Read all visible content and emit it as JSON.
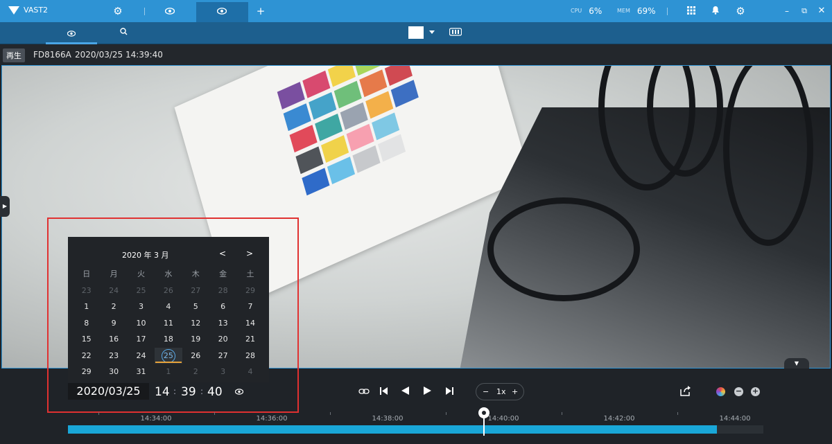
{
  "topbar": {
    "app_name": "VAST2",
    "cpu_label": "CPU",
    "cpu_value": "6%",
    "mem_label": "MEM",
    "mem_value": "69%",
    "icons": [
      "gear-icon",
      "eye-icon",
      "eye-icon",
      "plus-icon",
      "grid-icon",
      "bell-icon",
      "gear-icon",
      "minimize-icon",
      "restore-icon",
      "close-icon"
    ]
  },
  "subbar": {
    "icons": [
      "eye-icon",
      "search-icon",
      "color-swatch",
      "chevron-down-icon",
      "film-icon"
    ],
    "swatch_color": "#ffffff"
  },
  "camera": {
    "mode": "再生",
    "name": "FD8166A",
    "timestamp": "2020/03/25 14:39:40"
  },
  "calendar": {
    "header": "2020 年 3 月",
    "prev": "<",
    "next": ">",
    "weekdays": [
      "日",
      "月",
      "火",
      "水",
      "木",
      "金",
      "土"
    ],
    "days": [
      [
        "23",
        "24",
        "25",
        "26",
        "27",
        "28",
        "29"
      ],
      [
        "1",
        "2",
        "3",
        "4",
        "5",
        "6",
        "7"
      ],
      [
        "8",
        "9",
        "10",
        "11",
        "12",
        "13",
        "14"
      ],
      [
        "15",
        "16",
        "17",
        "18",
        "19",
        "20",
        "21"
      ],
      [
        "22",
        "23",
        "24",
        "25",
        "26",
        "27",
        "28"
      ],
      [
        "29",
        "30",
        "31",
        "1",
        "2",
        "3",
        "4"
      ]
    ],
    "selected_row": 4,
    "selected_col": 3
  },
  "playback": {
    "date": "2020/03/25",
    "hour": "14",
    "minute": "39",
    "second": "40",
    "speed": "1x",
    "speed_minus": "−",
    "speed_plus": "+"
  },
  "timeline": {
    "ticks": [
      "14:34:00",
      "14:36:00",
      "14:38:00",
      "14:40:00",
      "14:42:00",
      "14:44:00"
    ],
    "recorded_fraction": 0.933,
    "cursor_fraction": 0.6
  },
  "colors": {
    "accent": "#2e93d4",
    "recording": "#19a7d8",
    "highlight": "#e03131"
  }
}
